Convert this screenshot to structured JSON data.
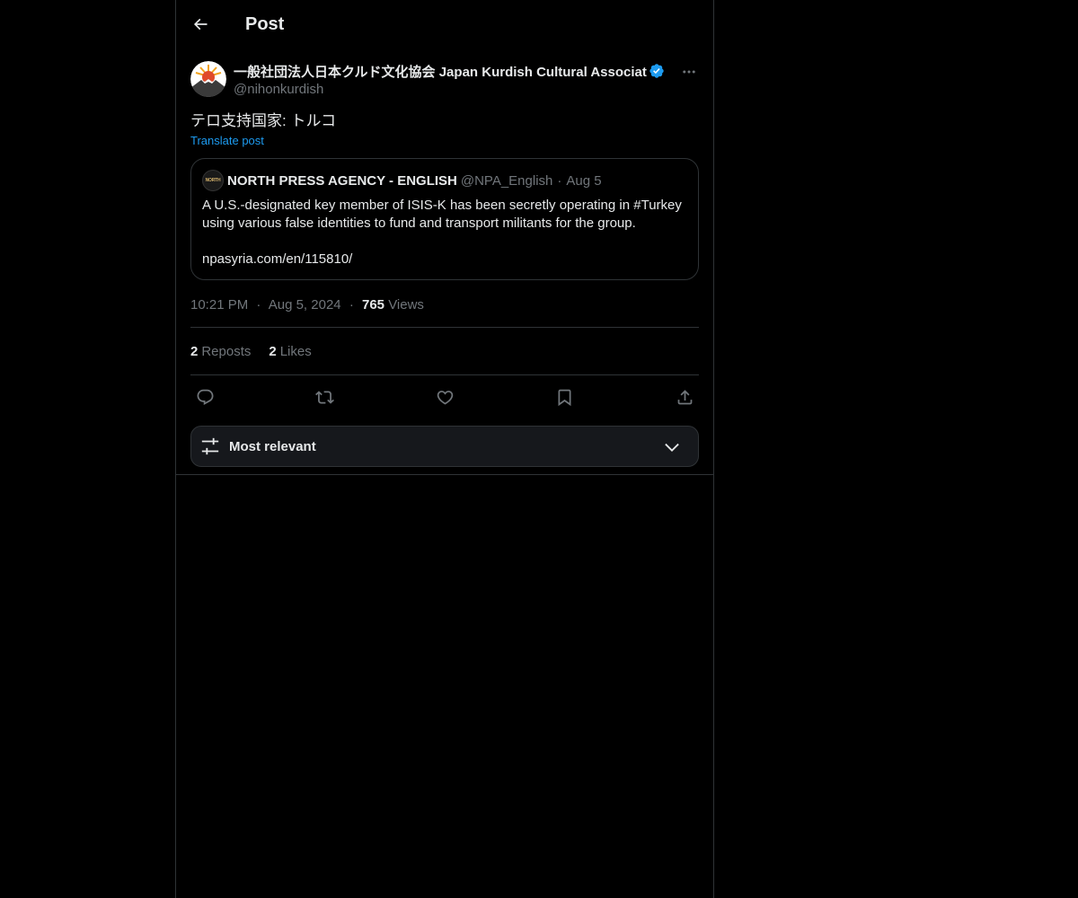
{
  "header": {
    "title": "Post"
  },
  "post": {
    "author": {
      "display_name": "一般社団法人日本クルド文化協会 Japan Kurdish Cultural Association",
      "handle": "@nihonkurdish",
      "verified": true
    },
    "text": "テロ支持国家: トルコ",
    "translate_label": "Translate post",
    "quoted": {
      "avatar_text": "NORTH",
      "name": "NORTH PRESS AGENCY - ENGLISH",
      "handle": "@NPA_English",
      "separator": "·",
      "date": "Aug 5",
      "text": "A U.S.-designated key member of ISIS-K has been secretly operating in #Turkey using various false identities to fund and transport militants for the group.\n\nnpasyria.com/en/115810/"
    },
    "time": "10:21 PM",
    "date": "Aug 5, 2024",
    "separator": "·",
    "views_count": "765",
    "views_label": "Views",
    "reposts_count": "2",
    "reposts_label": "Reposts",
    "likes_count": "2",
    "likes_label": "Likes"
  },
  "actions": {
    "reply_icon": "reply-icon",
    "repost_icon": "repost-icon",
    "like_icon": "heart-icon",
    "bookmark_icon": "bookmark-icon",
    "share_icon": "share-icon"
  },
  "sort": {
    "label": "Most relevant"
  },
  "colors": {
    "background": "#000000",
    "text": "#e7e9ea",
    "muted": "#71767b",
    "link": "#1d9bf0",
    "border": "#2f3336",
    "verified": "#1d9bf0"
  }
}
